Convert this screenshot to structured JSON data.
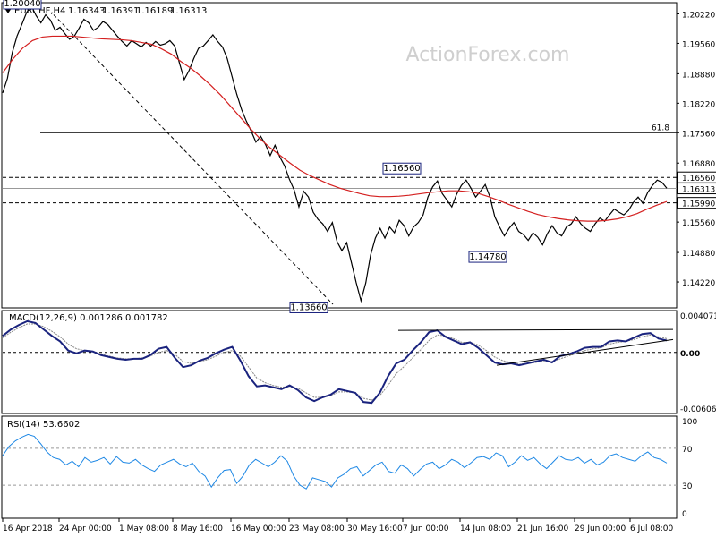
{
  "watermark": "ActionForex.com",
  "chart_data": [
    {
      "type": "line",
      "name": "price",
      "header": {
        "symbol": "EURCHF,H4",
        "open": "1.16343",
        "high": "1.16391",
        "low": "1.16189",
        "close": "1.16313"
      },
      "ylim": [
        1.1366,
        1.2045
      ],
      "y_ticks": [
        "1.20220",
        "1.19560",
        "1.18880",
        "1.18220",
        "1.17560",
        "1.16880",
        "1.16560",
        "1.16313",
        "1.15990",
        "1.15560",
        "1.14880",
        "1.14220"
      ],
      "x_ticks": [
        "16 Apr 2018",
        "24 Apr 00:00",
        "1 May 08:00",
        "8 May 16:00",
        "16 May 00:00",
        "23 May 08:00",
        "30 May 16:00",
        "7 Jun 00:00",
        "14 Jun 08:00",
        "21 Jun 16:00",
        "29 Jun 00:00",
        "6 Jul 08:00"
      ],
      "series": [
        {
          "values": [
            1.1845,
            1.1878,
            1.1935,
            1.1972,
            1.1998,
            1.2025,
            1.204,
            1.2018,
            1.2002,
            1.202,
            1.2008,
            1.1985,
            1.1992,
            1.1978,
            1.1965,
            1.1972,
            1.199,
            1.201,
            1.2002,
            1.1985,
            1.1992,
            1.2005,
            1.1998,
            1.1985,
            1.1972,
            1.196,
            1.195,
            1.1962,
            1.1955,
            1.1948,
            1.1958,
            1.195,
            1.196,
            1.1952,
            1.1955,
            1.1962,
            1.195,
            1.1912,
            1.1875,
            1.1895,
            1.1922,
            1.1945,
            1.195,
            1.1962,
            1.1975,
            1.196,
            1.1948,
            1.1922,
            1.1882,
            1.1842,
            1.1808,
            1.1782,
            1.176,
            1.1735,
            1.1748,
            1.173,
            1.1705,
            1.1728,
            1.1702,
            1.1682,
            1.1652,
            1.1628,
            1.159,
            1.1625,
            1.1612,
            1.1578,
            1.1562,
            1.1552,
            1.1535,
            1.1555,
            1.1512,
            1.1492,
            1.151,
            1.1465,
            1.142,
            1.138,
            1.142,
            1.1482,
            1.152,
            1.1542,
            1.152,
            1.1545,
            1.1532,
            1.156,
            1.1548,
            1.1525,
            1.1545,
            1.1555,
            1.1572,
            1.1612,
            1.1635,
            1.1648,
            1.162,
            1.1605,
            1.159,
            1.1618,
            1.1638,
            1.165,
            1.1632,
            1.1612,
            1.1625,
            1.164,
            1.1612,
            1.1568,
            1.1545,
            1.1525,
            1.1542,
            1.1555,
            1.1535,
            1.1528,
            1.1515,
            1.1532,
            1.1522,
            1.1505,
            1.153,
            1.1548,
            1.1532,
            1.1525,
            1.1545,
            1.1552,
            1.1568,
            1.1552,
            1.1542,
            1.1535,
            1.1552,
            1.1565,
            1.1558,
            1.1572,
            1.1585,
            1.1578,
            1.1572,
            1.1582,
            1.16,
            1.1612,
            1.1598,
            1.1622,
            1.1638,
            1.165,
            1.1645,
            1.1632
          ],
          "color": "#000000"
        },
        {
          "name": "MA",
          "values": [
            1.189,
            1.192,
            1.1945,
            1.1962,
            1.197,
            1.1972,
            1.1972,
            1.1972,
            1.197,
            1.1968,
            1.1966,
            1.1965,
            1.1964,
            1.1962,
            1.1958,
            1.1954,
            1.1944,
            1.1932,
            1.1915,
            1.19,
            1.1882,
            1.1862,
            1.184,
            1.1815,
            1.179,
            1.1765,
            1.1742,
            1.1722,
            1.1705,
            1.1688,
            1.1672,
            1.166,
            1.165,
            1.164,
            1.1632,
            1.1626,
            1.162,
            1.1615,
            1.1613,
            1.1613,
            1.1614,
            1.1616,
            1.1619,
            1.1622,
            1.1624,
            1.1626,
            1.1626,
            1.1624,
            1.162,
            1.1613,
            1.1605,
            1.1596,
            1.1588,
            1.158,
            1.1573,
            1.1568,
            1.1564,
            1.1561,
            1.1559,
            1.1558,
            1.1558,
            1.156,
            1.1563,
            1.1568,
            1.1575,
            1.1585,
            1.1594,
            1.1602
          ],
          "color": "#d42020"
        }
      ],
      "levels": [
        {
          "value": 1.1756,
          "label": "61.8"
        },
        {
          "value": 1.1656,
          "label": ""
        },
        {
          "value": 1.1599,
          "label": ""
        },
        {
          "value": 1.16313,
          "label": ""
        }
      ],
      "annotations": [
        "1.16560",
        "1.14780",
        "1.13660",
        "1.20040"
      ],
      "trendline": "dashed from 1.20040 to 1.13660"
    },
    {
      "type": "line",
      "name": "macd",
      "header": "MACD(12,26,9) 0.001286 0.001782",
      "ylim": [
        -0.006069,
        0.004071
      ],
      "y_ticks": [
        "0.004071",
        "0.00",
        "-0.006069"
      ],
      "series": [
        {
          "values": [
            0.0018,
            0.0025,
            0.003,
            0.0034,
            0.0032,
            0.0025,
            0.0018,
            0.0012,
            0.0002,
            -0.0001,
            0.0002,
            0.0001,
            -0.0003,
            -0.0005,
            -0.0007,
            -0.0008,
            -0.0007,
            -0.0007,
            -0.0003,
            0.0004,
            0.0006,
            -0.0006,
            -0.0016,
            -0.0014,
            -0.0009,
            -0.0006,
            -0.0001,
            0.0003,
            0.0006,
            -0.0009,
            -0.0026,
            -0.0037,
            -0.0036,
            -0.0038,
            -0.004,
            -0.0036,
            -0.0041,
            -0.0049,
            -0.0053,
            -0.0049,
            -0.0046,
            -0.004,
            -0.0042,
            -0.0044,
            -0.0054,
            -0.0055,
            -0.0044,
            -0.0026,
            -0.0012,
            -0.0008,
            0.0002,
            0.0011,
            0.0022,
            0.0024,
            0.0017,
            0.0013,
            0.0009,
            0.0011,
            0.0005,
            -0.0003,
            -0.0011,
            -0.0013,
            -0.0012,
            -0.0014,
            -0.0012,
            -0.001,
            -0.0008,
            -0.0011,
            -0.0004,
            -0.0002,
            0.0001,
            0.0005,
            0.0006,
            0.0006,
            0.0012,
            0.0013,
            0.0012,
            0.0016,
            0.002,
            0.0021,
            0.0015,
            0.0013
          ],
          "color": "#1a237e"
        },
        {
          "name": "signal",
          "values": [
            0.0016,
            0.0022,
            0.0027,
            0.0031,
            0.0031,
            0.0028,
            0.0023,
            0.0017,
            0.0009,
            0.0004,
            0.0002,
            0.0001,
            -0.0002,
            -0.0004,
            -0.0006,
            -0.0007,
            -0.0007,
            -0.0006,
            -0.0004,
            0.0,
            0.0002,
            -0.0002,
            -0.001,
            -0.0012,
            -0.001,
            -0.0008,
            -0.0004,
            0.0,
            0.0002,
            -0.0004,
            -0.0016,
            -0.0028,
            -0.0033,
            -0.0036,
            -0.0038,
            -0.0037,
            -0.0039,
            -0.0044,
            -0.0049,
            -0.0049,
            -0.0047,
            -0.0043,
            -0.0043,
            -0.0044,
            -0.005,
            -0.0052,
            -0.0047,
            -0.0036,
            -0.0023,
            -0.0015,
            -0.0006,
            0.0003,
            0.0013,
            0.0019,
            0.0018,
            0.0015,
            0.0011,
            0.0011,
            0.0008,
            0.0002,
            -0.0005,
            -0.0009,
            -0.0011,
            -0.0013,
            -0.0012,
            -0.0011,
            -0.0009,
            -0.001,
            -0.0007,
            -0.0004,
            -0.0001,
            0.0002,
            0.0004,
            0.0005,
            0.0009,
            0.0011,
            0.0012,
            0.0014,
            0.0017,
            0.0019,
            0.0017,
            0.0015
          ],
          "color": "#888888"
        }
      ]
    },
    {
      "type": "line",
      "name": "rsi",
      "header": "RSI(14) 53.6602",
      "ylim": [
        0,
        100
      ],
      "y_ticks": [
        "100",
        "70",
        "30",
        "0"
      ],
      "levels": [
        70,
        30
      ],
      "series": [
        {
          "values": [
            62,
            72,
            78,
            82,
            85,
            83,
            75,
            66,
            60,
            58,
            52,
            56,
            50,
            60,
            55,
            57,
            60,
            53,
            61,
            55,
            54,
            58,
            52,
            48,
            45,
            52,
            55,
            58,
            53,
            50,
            54,
            45,
            40,
            28,
            38,
            46,
            47,
            32,
            40,
            52,
            58,
            54,
            50,
            55,
            62,
            56,
            40,
            30,
            26,
            38,
            36,
            34,
            28,
            38,
            42,
            48,
            50,
            40,
            46,
            52,
            55,
            45,
            43,
            52,
            48,
            40,
            47,
            53,
            55,
            48,
            52,
            58,
            55,
            49,
            54,
            60,
            61,
            58,
            65,
            62,
            50,
            55,
            62,
            57,
            60,
            53,
            48,
            55,
            62,
            58,
            57,
            60,
            54,
            58,
            52,
            55,
            62,
            64,
            60,
            58,
            56,
            62,
            66,
            60,
            58,
            54
          ],
          "color": "#1e88e5"
        }
      ]
    }
  ]
}
